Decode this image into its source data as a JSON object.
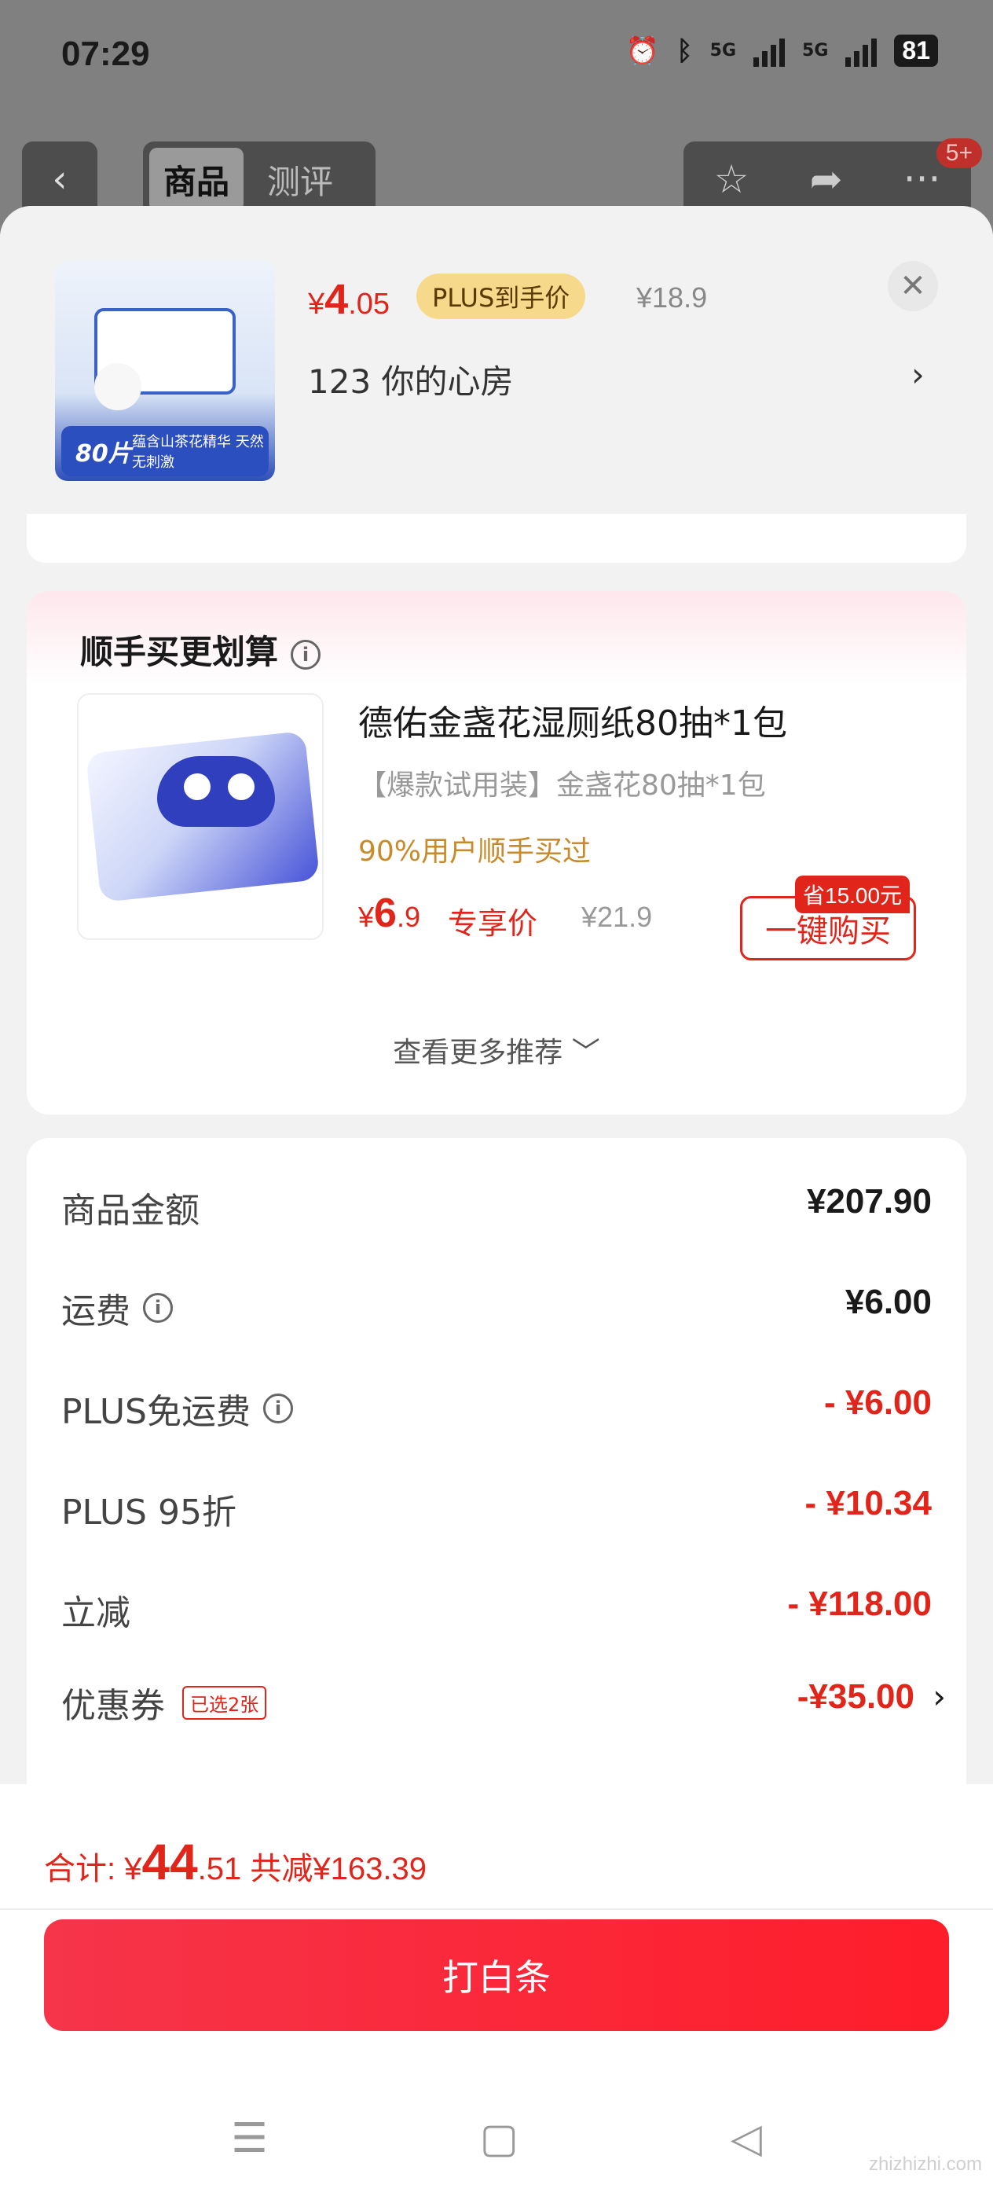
{
  "status_bar": {
    "time": "07:29",
    "signal_1": "5G",
    "signal_2": "5G",
    "battery": "81"
  },
  "nav": {
    "back": "‹",
    "tabs": [
      {
        "label": "商品"
      },
      {
        "label": "测评"
      }
    ],
    "badge": "5+"
  },
  "product": {
    "currency": "¥",
    "price_int": "4",
    "price_dec": ".05",
    "plus_label": "PLUS到手价",
    "original_price": "¥18.9",
    "variant": "123  你的心房",
    "thumb_tag_count": "80片",
    "thumb_tag_text": "蕴含山茶花精华 天然无刺激"
  },
  "bundle": {
    "title": "顺手买更划算",
    "name": "德佑金盏花湿厕纸80抽*1包",
    "subtitle": "【爆款试用装】金盏花80抽*1包",
    "note": "90%用户顺手买过",
    "currency": "¥",
    "price_int": "6",
    "price_dec": ".9",
    "exclusive_label": "专享价",
    "original_price": "¥21.9",
    "save_tag": "省15.00元",
    "buy_label": "一键购买",
    "more_label": "查看更多推荐 ﹀"
  },
  "summary": {
    "rows": [
      {
        "label": "商品金额",
        "value": "¥207.90"
      },
      {
        "label": "运费",
        "value": "¥6.00"
      },
      {
        "label": "PLUS免运费",
        "value": "- ¥6.00"
      },
      {
        "label": "PLUS 95折",
        "value": "- ¥10.34"
      },
      {
        "label": "立减",
        "value": "- ¥118.00"
      },
      {
        "label": "优惠券",
        "value": "-¥35.00",
        "chosen": "已选2张"
      }
    ]
  },
  "footer": {
    "total_label": "合计: ¥",
    "total_int": "44",
    "total_dec": ".51",
    "saved": "共减¥163.39",
    "pay_label": "打白条"
  },
  "watermark": "zhizhizhi.com",
  "colors": {
    "accent": "#e1251b",
    "plus_pill": "#f7d98b",
    "pay_button": "#fe1d2a"
  }
}
